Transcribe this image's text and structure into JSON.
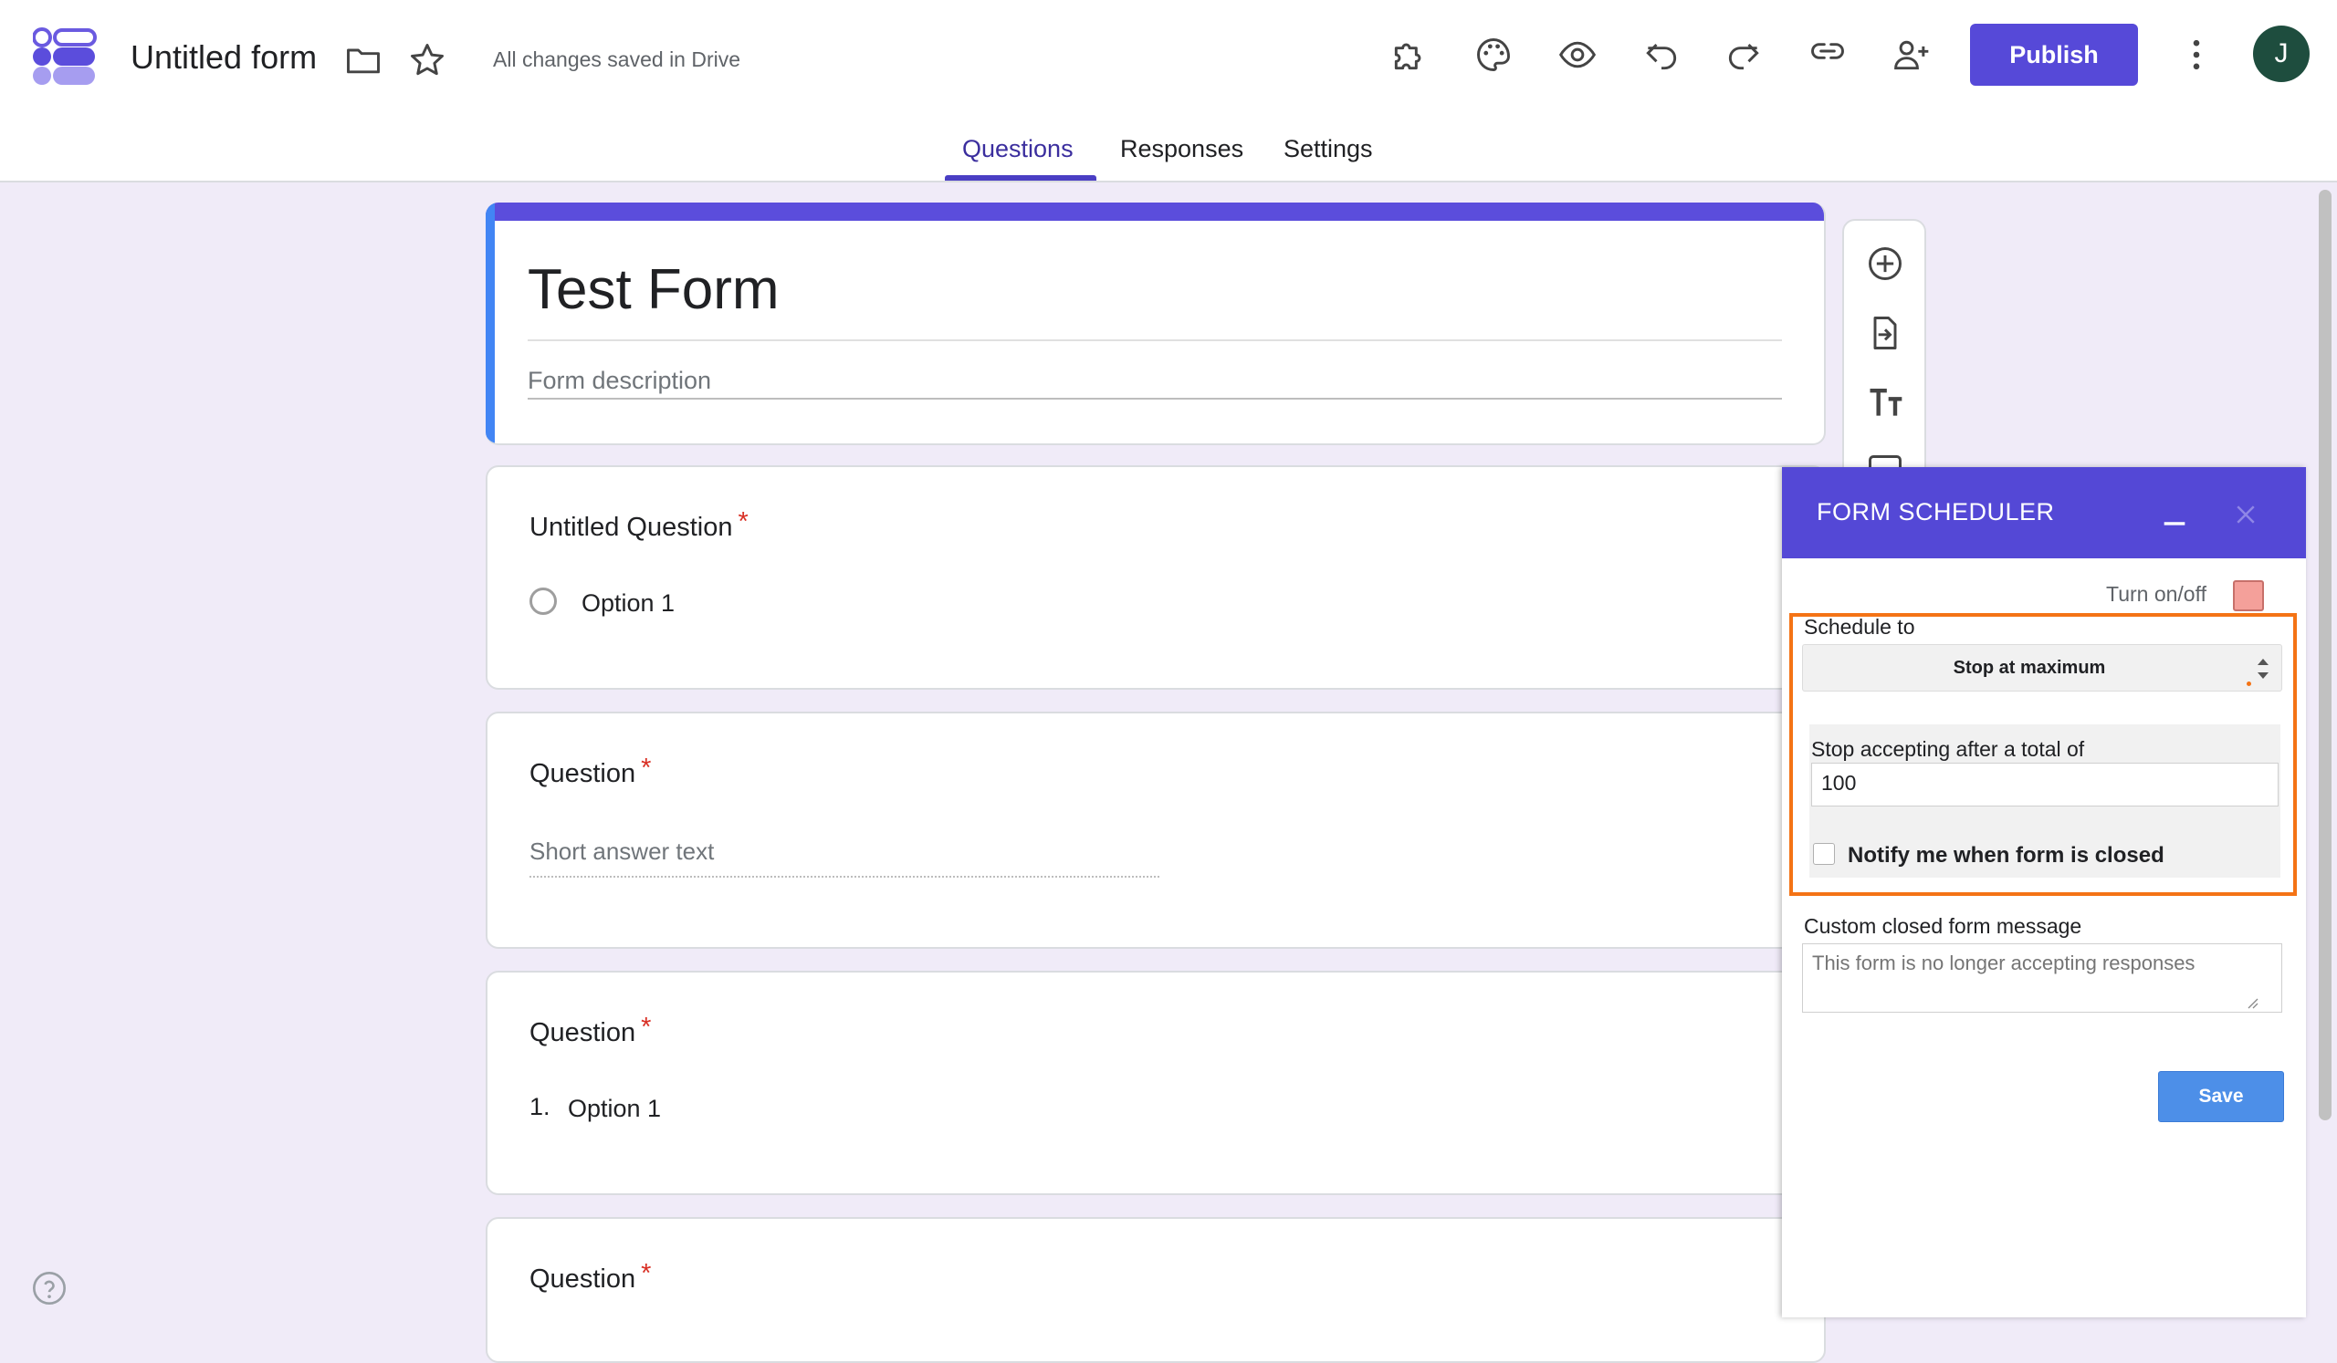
{
  "header": {
    "title": "Untitled form",
    "save_status": "All changes saved in Drive",
    "publish_label": "Publish",
    "avatar_initial": "J"
  },
  "tabs": [
    {
      "label": "Questions",
      "active": true
    },
    {
      "label": "Responses",
      "active": false
    },
    {
      "label": "Settings",
      "active": false
    }
  ],
  "form": {
    "title": "Test Form",
    "description_placeholder": "Form description",
    "questions": [
      {
        "title": "Untitled Question",
        "required": "*",
        "type": "multiple-choice",
        "options": [
          "Option 1"
        ]
      },
      {
        "title": "Question",
        "required": "*",
        "type": "short-answer",
        "placeholder": "Short answer text"
      },
      {
        "title": "Question",
        "required": "*",
        "type": "ordered-list",
        "number": "1.",
        "options": [
          "Option 1"
        ]
      },
      {
        "title": "Question",
        "required": "*"
      }
    ]
  },
  "icons": {
    "logo": "forms-logo-icon",
    "folder": "folder-icon",
    "star": "star-icon",
    "addons": "puzzle-icon",
    "theme": "palette-icon",
    "preview": "eye-icon",
    "undo": "undo-icon",
    "redo": "redo-icon",
    "link": "link-icon",
    "collaborators": "person-add-icon",
    "more": "more-vertical-icon",
    "help": "help-icon"
  },
  "scheduler": {
    "title": "FORM SCHEDULER",
    "toggle_label": "Turn on/off",
    "schedule_label": "Schedule to",
    "schedule_value": "Stop at maximum",
    "stop_label": "Stop accepting after a total of",
    "max_responses": "100",
    "notify_label": "Notify me when form is closed",
    "custom_message_label": "Custom closed form message",
    "custom_message_placeholder": "This form is no longer accepting responses",
    "save_label": "Save",
    "colors": {
      "header": "#5448d6",
      "highlight": "#f47315",
      "save": "#4d8fe8"
    }
  },
  "colors": {
    "accent": "#5649d8",
    "background": "#f0ebf8",
    "required": "#d93025"
  }
}
